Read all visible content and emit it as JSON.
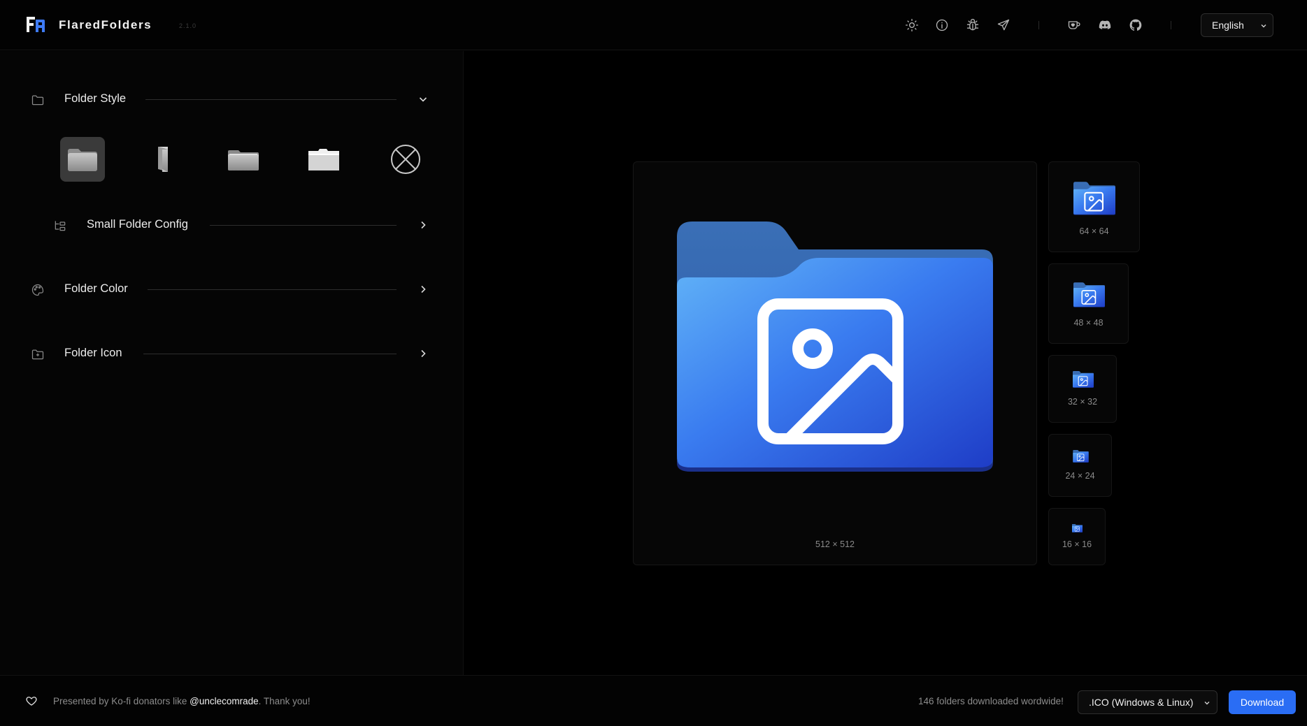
{
  "app": {
    "name": "FlaredFolders",
    "version": "2.1.0"
  },
  "header": {
    "icons": [
      "sun-icon",
      "info-icon",
      "bug-icon",
      "send-icon",
      "kofi-icon",
      "discord-icon",
      "github-icon"
    ],
    "language": "English"
  },
  "sidebar": {
    "folder_style": {
      "label": "Folder Style",
      "expanded": true
    },
    "style_options": [
      "win11-folder",
      "open-side-folder",
      "flat-folder",
      "tabbed-folder",
      "none-option"
    ],
    "small_folder_config": {
      "label": "Small Folder Config"
    },
    "folder_color": {
      "label": "Folder Color"
    },
    "folder_icon": {
      "label": "Folder Icon"
    }
  },
  "preview": {
    "main_label": "512 × 512",
    "sizes": [
      "64 × 64",
      "48 × 48",
      "32 × 32",
      "24 × 24",
      "16 × 16"
    ]
  },
  "footer": {
    "credits_prefix": "Presented by Ko-fi donators like ",
    "credits_user": "@unclecomrade",
    "credits_suffix": ". Thank you!",
    "download_count": "146 folders downloaded wordwide!",
    "format": ".ICO (Windows & Linux)",
    "download_label": "Download"
  },
  "colors": {
    "accent": "#2a6df4",
    "folder_back": "#2f66b8",
    "folder_front_top": "#5aa9f5",
    "folder_front_bottom": "#1f3fc8"
  }
}
